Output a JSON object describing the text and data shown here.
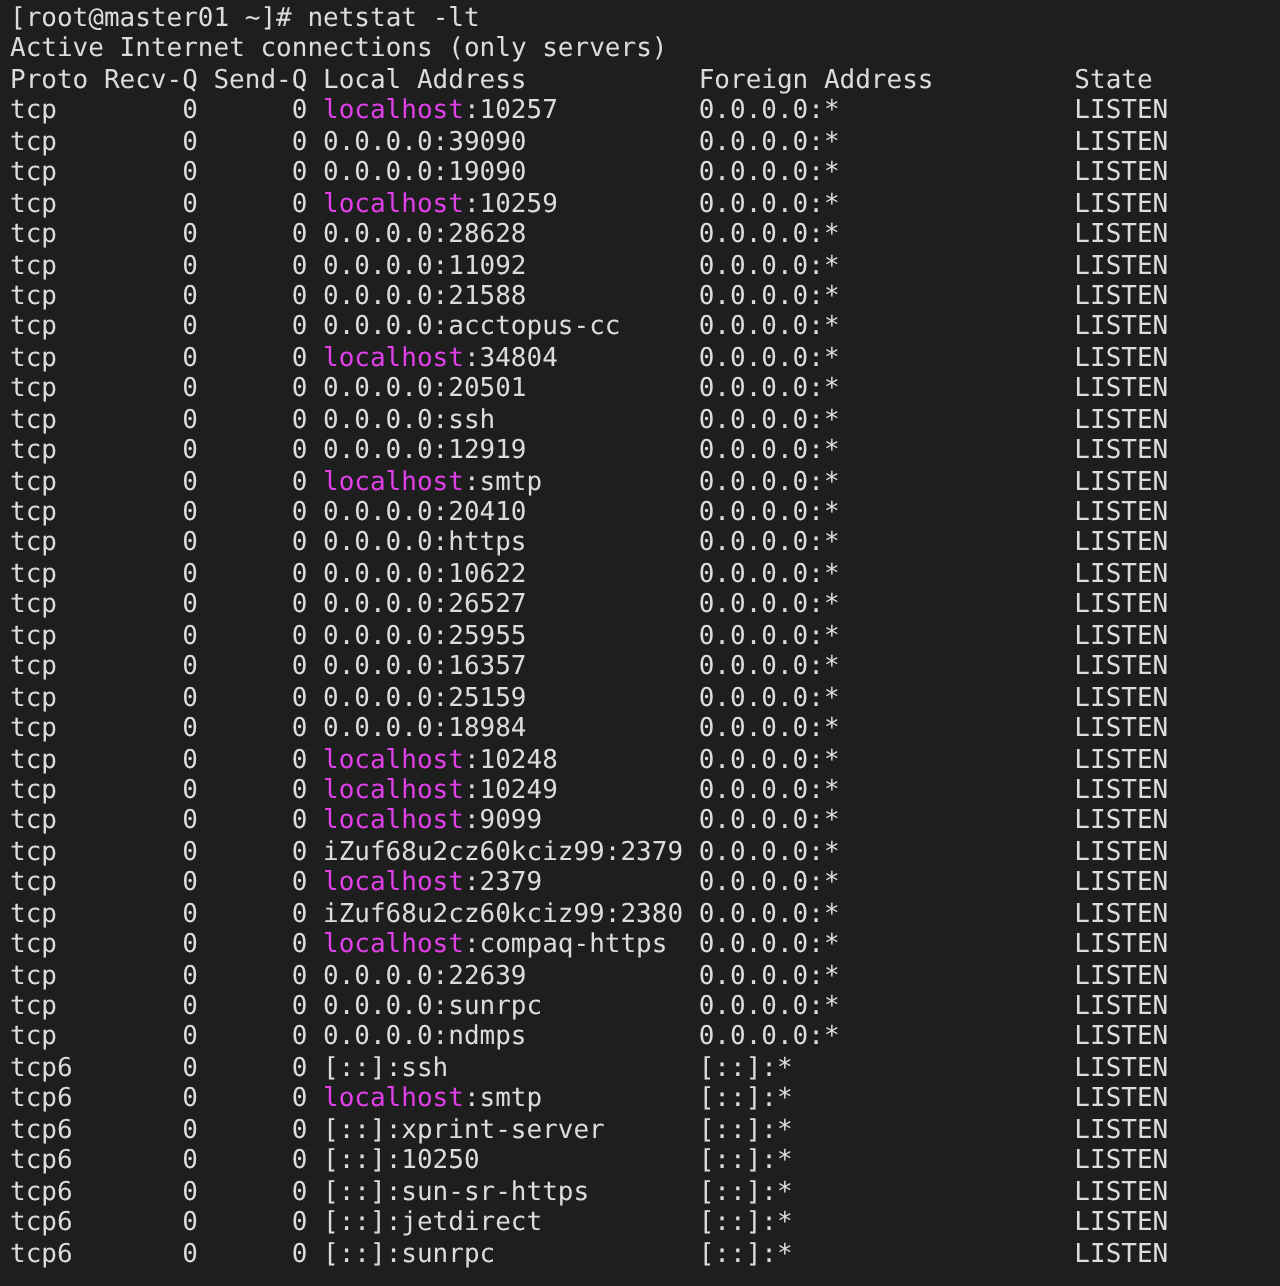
{
  "terminal": {
    "prompt": "[root@master01 ~]# netstat -lt",
    "heading": "Active Internet connections (only servers)",
    "columns": [
      "Proto",
      "Recv-Q",
      "Send-Q",
      "Local Address",
      "Foreign Address",
      "State"
    ],
    "rows": [
      {
        "proto": "tcp",
        "recv_q": "0",
        "send_q": "0",
        "local_host": "localhost",
        "local_port": ":10257",
        "host_highlighted": true,
        "foreign_address": "0.0.0.0:*",
        "state": "LISTEN"
      },
      {
        "proto": "tcp",
        "recv_q": "0",
        "send_q": "0",
        "local_host": "0.0.0.0",
        "local_port": ":39090",
        "host_highlighted": false,
        "foreign_address": "0.0.0.0:*",
        "state": "LISTEN"
      },
      {
        "proto": "tcp",
        "recv_q": "0",
        "send_q": "0",
        "local_host": "0.0.0.0",
        "local_port": ":19090",
        "host_highlighted": false,
        "foreign_address": "0.0.0.0:*",
        "state": "LISTEN"
      },
      {
        "proto": "tcp",
        "recv_q": "0",
        "send_q": "0",
        "local_host": "localhost",
        "local_port": ":10259",
        "host_highlighted": true,
        "foreign_address": "0.0.0.0:*",
        "state": "LISTEN"
      },
      {
        "proto": "tcp",
        "recv_q": "0",
        "send_q": "0",
        "local_host": "0.0.0.0",
        "local_port": ":28628",
        "host_highlighted": false,
        "foreign_address": "0.0.0.0:*",
        "state": "LISTEN"
      },
      {
        "proto": "tcp",
        "recv_q": "0",
        "send_q": "0",
        "local_host": "0.0.0.0",
        "local_port": ":11092",
        "host_highlighted": false,
        "foreign_address": "0.0.0.0:*",
        "state": "LISTEN"
      },
      {
        "proto": "tcp",
        "recv_q": "0",
        "send_q": "0",
        "local_host": "0.0.0.0",
        "local_port": ":21588",
        "host_highlighted": false,
        "foreign_address": "0.0.0.0:*",
        "state": "LISTEN"
      },
      {
        "proto": "tcp",
        "recv_q": "0",
        "send_q": "0",
        "local_host": "0.0.0.0",
        "local_port": ":acctopus-cc",
        "host_highlighted": false,
        "foreign_address": "0.0.0.0:*",
        "state": "LISTEN"
      },
      {
        "proto": "tcp",
        "recv_q": "0",
        "send_q": "0",
        "local_host": "localhost",
        "local_port": ":34804",
        "host_highlighted": true,
        "foreign_address": "0.0.0.0:*",
        "state": "LISTEN"
      },
      {
        "proto": "tcp",
        "recv_q": "0",
        "send_q": "0",
        "local_host": "0.0.0.0",
        "local_port": ":20501",
        "host_highlighted": false,
        "foreign_address": "0.0.0.0:*",
        "state": "LISTEN"
      },
      {
        "proto": "tcp",
        "recv_q": "0",
        "send_q": "0",
        "local_host": "0.0.0.0",
        "local_port": ":ssh",
        "host_highlighted": false,
        "foreign_address": "0.0.0.0:*",
        "state": "LISTEN"
      },
      {
        "proto": "tcp",
        "recv_q": "0",
        "send_q": "0",
        "local_host": "0.0.0.0",
        "local_port": ":12919",
        "host_highlighted": false,
        "foreign_address": "0.0.0.0:*",
        "state": "LISTEN"
      },
      {
        "proto": "tcp",
        "recv_q": "0",
        "send_q": "0",
        "local_host": "localhost",
        "local_port": ":smtp",
        "host_highlighted": true,
        "foreign_address": "0.0.0.0:*",
        "state": "LISTEN"
      },
      {
        "proto": "tcp",
        "recv_q": "0",
        "send_q": "0",
        "local_host": "0.0.0.0",
        "local_port": ":20410",
        "host_highlighted": false,
        "foreign_address": "0.0.0.0:*",
        "state": "LISTEN"
      },
      {
        "proto": "tcp",
        "recv_q": "0",
        "send_q": "0",
        "local_host": "0.0.0.0",
        "local_port": ":https",
        "host_highlighted": false,
        "foreign_address": "0.0.0.0:*",
        "state": "LISTEN"
      },
      {
        "proto": "tcp",
        "recv_q": "0",
        "send_q": "0",
        "local_host": "0.0.0.0",
        "local_port": ":10622",
        "host_highlighted": false,
        "foreign_address": "0.0.0.0:*",
        "state": "LISTEN"
      },
      {
        "proto": "tcp",
        "recv_q": "0",
        "send_q": "0",
        "local_host": "0.0.0.0",
        "local_port": ":26527",
        "host_highlighted": false,
        "foreign_address": "0.0.0.0:*",
        "state": "LISTEN"
      },
      {
        "proto": "tcp",
        "recv_q": "0",
        "send_q": "0",
        "local_host": "0.0.0.0",
        "local_port": ":25955",
        "host_highlighted": false,
        "foreign_address": "0.0.0.0:*",
        "state": "LISTEN"
      },
      {
        "proto": "tcp",
        "recv_q": "0",
        "send_q": "0",
        "local_host": "0.0.0.0",
        "local_port": ":16357",
        "host_highlighted": false,
        "foreign_address": "0.0.0.0:*",
        "state": "LISTEN"
      },
      {
        "proto": "tcp",
        "recv_q": "0",
        "send_q": "0",
        "local_host": "0.0.0.0",
        "local_port": ":25159",
        "host_highlighted": false,
        "foreign_address": "0.0.0.0:*",
        "state": "LISTEN"
      },
      {
        "proto": "tcp",
        "recv_q": "0",
        "send_q": "0",
        "local_host": "0.0.0.0",
        "local_port": ":18984",
        "host_highlighted": false,
        "foreign_address": "0.0.0.0:*",
        "state": "LISTEN"
      },
      {
        "proto": "tcp",
        "recv_q": "0",
        "send_q": "0",
        "local_host": "localhost",
        "local_port": ":10248",
        "host_highlighted": true,
        "foreign_address": "0.0.0.0:*",
        "state": "LISTEN"
      },
      {
        "proto": "tcp",
        "recv_q": "0",
        "send_q": "0",
        "local_host": "localhost",
        "local_port": ":10249",
        "host_highlighted": true,
        "foreign_address": "0.0.0.0:*",
        "state": "LISTEN"
      },
      {
        "proto": "tcp",
        "recv_q": "0",
        "send_q": "0",
        "local_host": "localhost",
        "local_port": ":9099",
        "host_highlighted": true,
        "foreign_address": "0.0.0.0:*",
        "state": "LISTEN"
      },
      {
        "proto": "tcp",
        "recv_q": "0",
        "send_q": "0",
        "local_host": "iZuf68u2cz60kciz99",
        "local_port": ":2379",
        "host_highlighted": false,
        "foreign_address": "0.0.0.0:*",
        "state": "LISTEN"
      },
      {
        "proto": "tcp",
        "recv_q": "0",
        "send_q": "0",
        "local_host": "localhost",
        "local_port": ":2379",
        "host_highlighted": true,
        "foreign_address": "0.0.0.0:*",
        "state": "LISTEN"
      },
      {
        "proto": "tcp",
        "recv_q": "0",
        "send_q": "0",
        "local_host": "iZuf68u2cz60kciz99",
        "local_port": ":2380",
        "host_highlighted": false,
        "foreign_address": "0.0.0.0:*",
        "state": "LISTEN"
      },
      {
        "proto": "tcp",
        "recv_q": "0",
        "send_q": "0",
        "local_host": "localhost",
        "local_port": ":compaq-https",
        "host_highlighted": true,
        "foreign_address": "0.0.0.0:*",
        "state": "LISTEN"
      },
      {
        "proto": "tcp",
        "recv_q": "0",
        "send_q": "0",
        "local_host": "0.0.0.0",
        "local_port": ":22639",
        "host_highlighted": false,
        "foreign_address": "0.0.0.0:*",
        "state": "LISTEN"
      },
      {
        "proto": "tcp",
        "recv_q": "0",
        "send_q": "0",
        "local_host": "0.0.0.0",
        "local_port": ":sunrpc",
        "host_highlighted": false,
        "foreign_address": "0.0.0.0:*",
        "state": "LISTEN"
      },
      {
        "proto": "tcp",
        "recv_q": "0",
        "send_q": "0",
        "local_host": "0.0.0.0",
        "local_port": ":ndmps",
        "host_highlighted": false,
        "foreign_address": "0.0.0.0:*",
        "state": "LISTEN"
      },
      {
        "proto": "tcp6",
        "recv_q": "0",
        "send_q": "0",
        "local_host": "[::]",
        "local_port": ":ssh",
        "host_highlighted": false,
        "foreign_address": "[::]:*",
        "state": "LISTEN"
      },
      {
        "proto": "tcp6",
        "recv_q": "0",
        "send_q": "0",
        "local_host": "localhost",
        "local_port": ":smtp",
        "host_highlighted": true,
        "foreign_address": "[::]:*",
        "state": "LISTEN"
      },
      {
        "proto": "tcp6",
        "recv_q": "0",
        "send_q": "0",
        "local_host": "[::]",
        "local_port": ":xprint-server",
        "host_highlighted": false,
        "foreign_address": "[::]:*",
        "state": "LISTEN"
      },
      {
        "proto": "tcp6",
        "recv_q": "0",
        "send_q": "0",
        "local_host": "[::]",
        "local_port": ":10250",
        "host_highlighted": false,
        "foreign_address": "[::]:*",
        "state": "LISTEN"
      },
      {
        "proto": "tcp6",
        "recv_q": "0",
        "send_q": "0",
        "local_host": "[::]",
        "local_port": ":sun-sr-https",
        "host_highlighted": false,
        "foreign_address": "[::]:*",
        "state": "LISTEN"
      },
      {
        "proto": "tcp6",
        "recv_q": "0",
        "send_q": "0",
        "local_host": "[::]",
        "local_port": ":jetdirect",
        "host_highlighted": false,
        "foreign_address": "[::]:*",
        "state": "LISTEN"
      },
      {
        "proto": "tcp6",
        "recv_q": "0",
        "send_q": "0",
        "local_host": "[::]",
        "local_port": ":sunrpc",
        "host_highlighted": false,
        "foreign_address": "[::]:*",
        "state": "LISTEN"
      }
    ]
  }
}
